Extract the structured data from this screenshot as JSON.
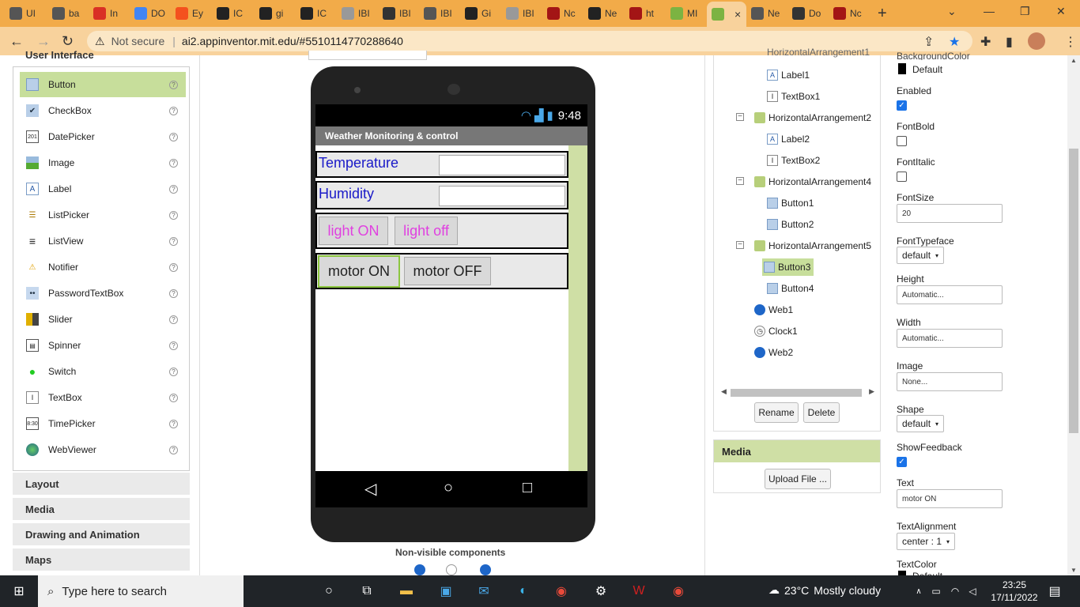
{
  "browser": {
    "tabs": [
      {
        "label": "UI",
        "color": "#555"
      },
      {
        "label": "ba",
        "color": "#555"
      },
      {
        "label": "In",
        "color": "#d93025"
      },
      {
        "label": "DO",
        "color": "#4285f4"
      },
      {
        "label": "Ey",
        "color": "#f4511e"
      },
      {
        "label": "IC",
        "color": "#222"
      },
      {
        "label": "gi",
        "color": "#222"
      },
      {
        "label": "IC",
        "color": "#222"
      },
      {
        "label": "IBI",
        "color": "#999"
      },
      {
        "label": "IBI",
        "color": "#333"
      },
      {
        "label": "IBI",
        "color": "#555"
      },
      {
        "label": "Gi",
        "color": "#222"
      },
      {
        "label": "IBI",
        "color": "#999"
      },
      {
        "label": "Nc",
        "color": "#a31515"
      },
      {
        "label": "Ne",
        "color": "#222"
      },
      {
        "label": "ht",
        "color": "#a31515"
      },
      {
        "label": "MI",
        "color": "#7cb342"
      },
      {
        "label": "",
        "color": "#7cb342"
      },
      {
        "label": "Ne",
        "color": "#555"
      },
      {
        "label": "Do",
        "color": "#333"
      },
      {
        "label": "Nc",
        "color": "#a31515"
      }
    ],
    "not_secure": "Not secure",
    "url": "ai2.appinventor.mit.edu/#5510114770288640"
  },
  "palette": {
    "header": "User Interface",
    "items": [
      {
        "label": "Button"
      },
      {
        "label": "CheckBox"
      },
      {
        "label": "DatePicker"
      },
      {
        "label": "Image"
      },
      {
        "label": "Label"
      },
      {
        "label": "ListPicker"
      },
      {
        "label": "ListView"
      },
      {
        "label": "Notifier"
      },
      {
        "label": "PasswordTextBox"
      },
      {
        "label": "Slider"
      },
      {
        "label": "Spinner"
      },
      {
        "label": "Switch"
      },
      {
        "label": "TextBox"
      },
      {
        "label": "TimePicker"
      },
      {
        "label": "WebViewer"
      }
    ],
    "help": "?",
    "categories": [
      "Layout",
      "Media",
      "Drawing and Animation",
      "Maps"
    ]
  },
  "viewer": {
    "status_time": "9:48",
    "app_title": "Weather Monitoring & control",
    "temperature_label": "Temperature",
    "humidity_label": "Humidity",
    "light_on": "light ON",
    "light_off": "light off",
    "motor_on": "motor ON",
    "motor_off": "motor OFF",
    "nonvisible_title": "Non-visible components"
  },
  "components": {
    "partial_top": "HorizontalArrangement1",
    "tree": [
      {
        "label": "Label1"
      },
      {
        "label": "TextBox1"
      },
      {
        "label": "HorizontalArrangement2"
      },
      {
        "label": "Label2"
      },
      {
        "label": "TextBox2"
      },
      {
        "label": "HorizontalArrangement4"
      },
      {
        "label": "Button1"
      },
      {
        "label": "Button2"
      },
      {
        "label": "HorizontalArrangement5"
      },
      {
        "label": "Button3"
      },
      {
        "label": "Button4"
      },
      {
        "label": "Web1"
      },
      {
        "label": "Clock1"
      },
      {
        "label": "Web2"
      }
    ],
    "toggle_symbol": "⊟",
    "rename": "Rename",
    "delete": "Delete"
  },
  "media": {
    "title": "Media",
    "upload": "Upload File ..."
  },
  "properties": {
    "bg_color_label": "BackgroundColor",
    "bg_color_value": "Default",
    "enabled_label": "Enabled",
    "fontbold_label": "FontBold",
    "fontitalic_label": "FontItalic",
    "fontsize_label": "FontSize",
    "fontsize_value": "20",
    "typeface_label": "FontTypeface",
    "typeface_value": "default",
    "height_label": "Height",
    "height_value": "Automatic...",
    "width_label": "Width",
    "width_value": "Automatic...",
    "image_label": "Image",
    "image_value": "None...",
    "shape_label": "Shape",
    "shape_value": "default",
    "showfeedback_label": "ShowFeedback",
    "text_label": "Text",
    "text_value": "motor ON",
    "alignment_label": "TextAlignment",
    "alignment_value": "center : 1",
    "textcolor_label": "TextColor",
    "textcolor_value": "Default"
  },
  "taskbar": {
    "search_placeholder": "Type here to search",
    "temperature": "23°C",
    "weather": "Mostly cloudy",
    "time": "23:25",
    "date": "17/11/2022"
  }
}
